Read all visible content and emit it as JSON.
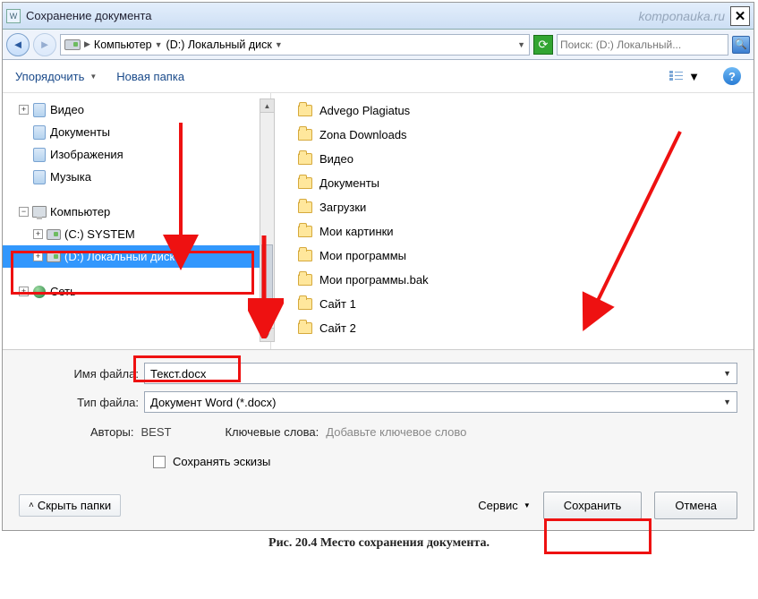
{
  "title": "Сохранение документа",
  "watermark": "komponauka.ru",
  "breadcrumb": {
    "seg1": "Компьютер",
    "seg2": "(D:) Локальный диск"
  },
  "search_placeholder": "Поиск: (D:) Локальный...",
  "toolbar": {
    "organize": "Упорядочить",
    "new_folder": "Новая папка"
  },
  "tree": {
    "libs": [
      {
        "label": "Видео"
      },
      {
        "label": "Документы"
      },
      {
        "label": "Изображения"
      },
      {
        "label": "Музыка"
      }
    ],
    "computer": "Компьютер",
    "drives": [
      {
        "label": "(C:) SYSTEM"
      },
      {
        "label": "(D:) Локальный диск",
        "selected": true
      }
    ],
    "network": "Сеть"
  },
  "files": [
    "Advego Plagiatus",
    "Zona Downloads",
    "Видео",
    "Документы",
    "Загрузки",
    "Мои картинки",
    "Мои программы",
    "Мои программы.bak",
    "Сайт 1",
    "Сайт 2"
  ],
  "form": {
    "filename_label": "Имя файла:",
    "filename_value": "Текст.docx",
    "filetype_label": "Тип файла:",
    "filetype_value": "Документ Word (*.docx)",
    "authors_label": "Авторы:",
    "authors_value": "BEST",
    "keywords_label": "Ключевые слова:",
    "keywords_hint": "Добавьте ключевое слово",
    "save_thumbs": "Сохранять эскизы"
  },
  "footer": {
    "hide_folders": "Скрыть папки",
    "service": "Сервис",
    "save": "Сохранить",
    "cancel": "Отмена"
  },
  "caption": "Рис. 20.4  Место сохранения документа."
}
